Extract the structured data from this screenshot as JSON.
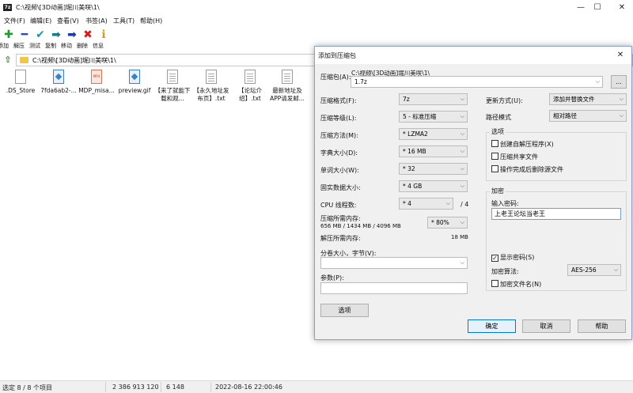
{
  "window": {
    "icon_text": "7z",
    "title": "C:\\视频\\[3D动画]堀川美咲\\1\\",
    "minimize": "—",
    "maximize": "☐",
    "close": "✕"
  },
  "menu": [
    "文件(F)",
    "编辑(E)",
    "查看(V)",
    "书签(A)",
    "工具(T)",
    "帮助(H)"
  ],
  "toolbar": [
    {
      "label": "添加",
      "icon": "plus-icon",
      "glyph": "✚",
      "color": "#1e9e2e"
    },
    {
      "label": "解压",
      "icon": "minus-icon",
      "glyph": "━",
      "color": "#2a4fb0"
    },
    {
      "label": "测试",
      "icon": "check-icon",
      "glyph": "✔",
      "color": "#1a9aa8"
    },
    {
      "label": "复制",
      "icon": "copy-arrow-icon",
      "glyph": "➡",
      "color": "#1a7a8a"
    },
    {
      "label": "移动",
      "icon": "move-arrow-icon",
      "glyph": "➡",
      "color": "#1a3f9a"
    },
    {
      "label": "删除",
      "icon": "delete-icon",
      "glyph": "✖",
      "color": "#d21f1f"
    },
    {
      "label": "信息",
      "icon": "info-icon",
      "glyph": "ℹ",
      "color": "#c8a010"
    }
  ],
  "address": {
    "path": "C:\\视频\\[3D动画]堀川美咲\\1\\"
  },
  "files": [
    {
      "name": ".DS_Store",
      "type": "file"
    },
    {
      "name": "7fda6ab2-...",
      "type": "img"
    },
    {
      "name": "MDP_misa...",
      "type": "mp4"
    },
    {
      "name": "preview.gif",
      "type": "img"
    },
    {
      "name": "【来了就能下载和观...",
      "type": "txt"
    },
    {
      "name": "【永久地址发布页】.txt",
      "type": "txt"
    },
    {
      "name": "【论坛介绍】.txt",
      "type": "txt"
    },
    {
      "name": "最新地址及APP请发邮...",
      "type": "txt"
    }
  ],
  "status": {
    "selection": "选定 8 / 8 个项目",
    "size": "2 386 913 120",
    "packed": "6 148",
    "modified": "2022-08-16 22:00:46"
  },
  "dialog": {
    "title": "添加到压缩包",
    "archive_label": "压缩包(A):",
    "archive_dir": "C:\\视频\\[3D动画]堀川美咲\\1\\",
    "archive_name": "1.7z",
    "browse": "...",
    "format_label": "压缩格式(F):",
    "format_value": "7z",
    "level_label": "压缩等级(L):",
    "level_value": "5 - 标准压缩",
    "method_label": "压缩方法(M):",
    "method_value": "* LZMA2",
    "dict_label": "字典大小(D):",
    "dict_value": "* 16 MB",
    "word_label": "单词大小(W):",
    "word_value": "* 32",
    "solid_label": "固实数据大小:",
    "solid_value": "* 4 GB",
    "cpu_label": "CPU 线程数:",
    "cpu_value": "* 4",
    "cpu_max": "/ 4",
    "mem_comp_label": "压缩所需内存:",
    "mem_comp_detail": "656 MB / 1434 MB / 4096 MB",
    "mem_comp_value": "* 80%",
    "mem_decomp_label": "解压所需内存:",
    "mem_decomp_value": "18 MB",
    "split_label": "分卷大小，字节(V):",
    "split_value": "",
    "params_label": "参数(P):",
    "params_value": "",
    "options_button": "选项",
    "update_label": "更新方式(U):",
    "update_value": "添加并替换文件",
    "path_label": "路径模式",
    "path_value": "相对路径",
    "options_group": "选项",
    "opt_sfx": "创建自解压程序(X)",
    "opt_shared": "压缩共享文件",
    "opt_delete": "操作完成后删除源文件",
    "encrypt_group": "加密",
    "password_label": "输入密码:",
    "password_value": "上老王论坛当老王",
    "show_password": "显示密码(S)",
    "show_password_checked": "✓",
    "enc_method_label": "加密算法:",
    "enc_method_value": "AES-256",
    "encrypt_names": "加密文件名(N)",
    "ok": "确定",
    "cancel": "取消",
    "help": "帮助",
    "combo_arrow": "⌵",
    "close": "✕"
  }
}
